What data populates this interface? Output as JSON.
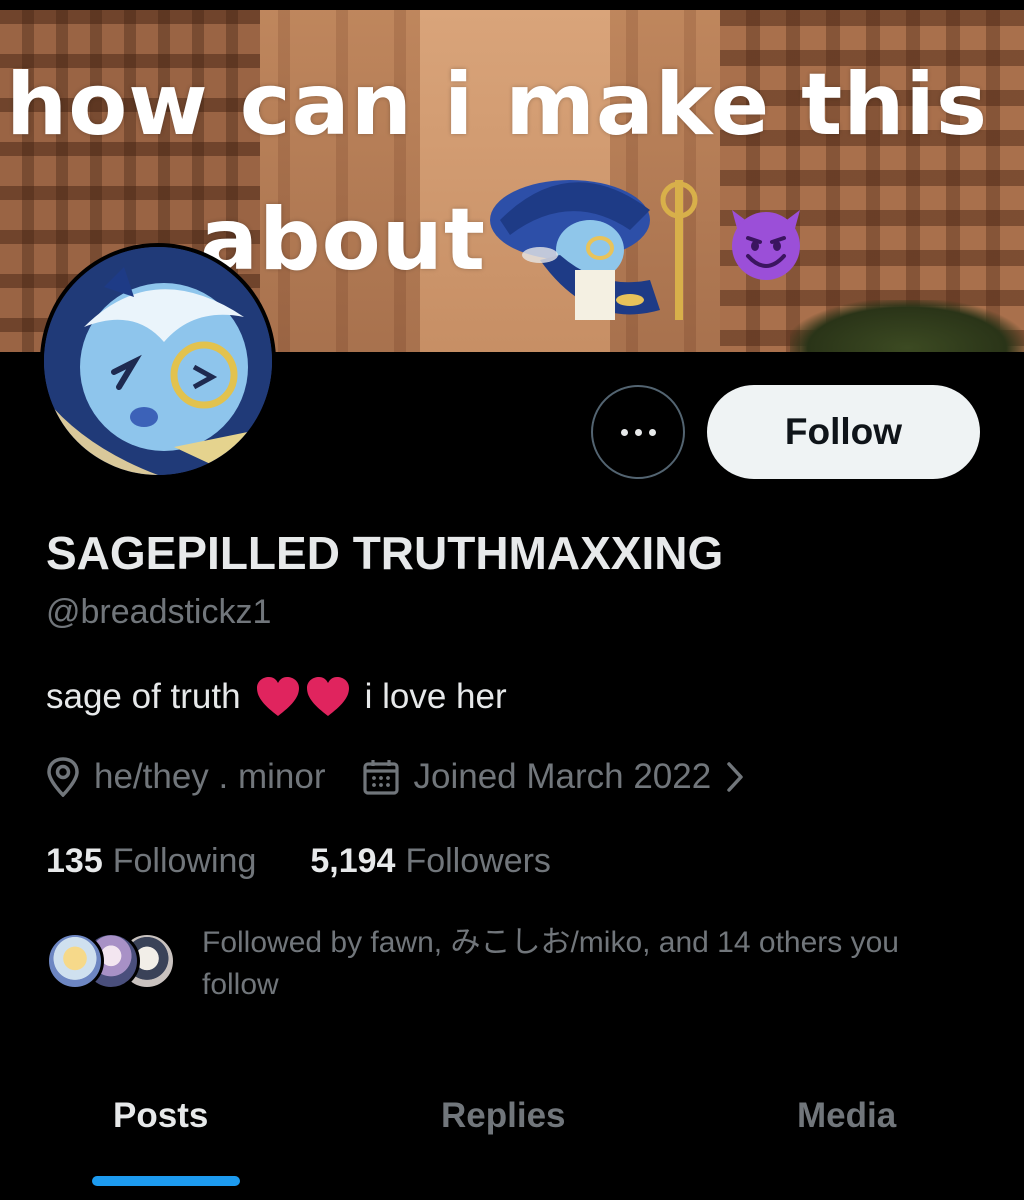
{
  "banner": {
    "line1": "how can i make this",
    "line2": "about"
  },
  "profile": {
    "display_name": "SAGEPILLED TRUTHMAXXING",
    "handle": "@breadstickz1",
    "bio_before": "sage of truth",
    "bio_after": "i love her",
    "location": "he/they . minor",
    "joined": "Joined March 2022",
    "following_count": "135",
    "following_label": "Following",
    "followers_count": "5,194",
    "followers_label": "Followers",
    "followed_by": "Followed by fawn, みこしお/miko, and 14 others you follow"
  },
  "actions": {
    "follow_label": "Follow"
  },
  "tabs": [
    {
      "label": "Posts",
      "active": true
    },
    {
      "label": "Replies",
      "active": false
    },
    {
      "label": "Media",
      "active": false
    }
  ],
  "colors": {
    "background": "#000000",
    "primary_text": "#e7e9ea",
    "secondary_text": "#71767b",
    "accent": "#1d9bf0",
    "follow_button_bg": "#eff3f4",
    "heart": "#e0245e"
  },
  "icons": {
    "more": "more-dots-icon",
    "location": "location-pin-icon",
    "calendar": "calendar-icon",
    "chevron": "chevron-right-icon",
    "heart": "red-heart-icon"
  }
}
